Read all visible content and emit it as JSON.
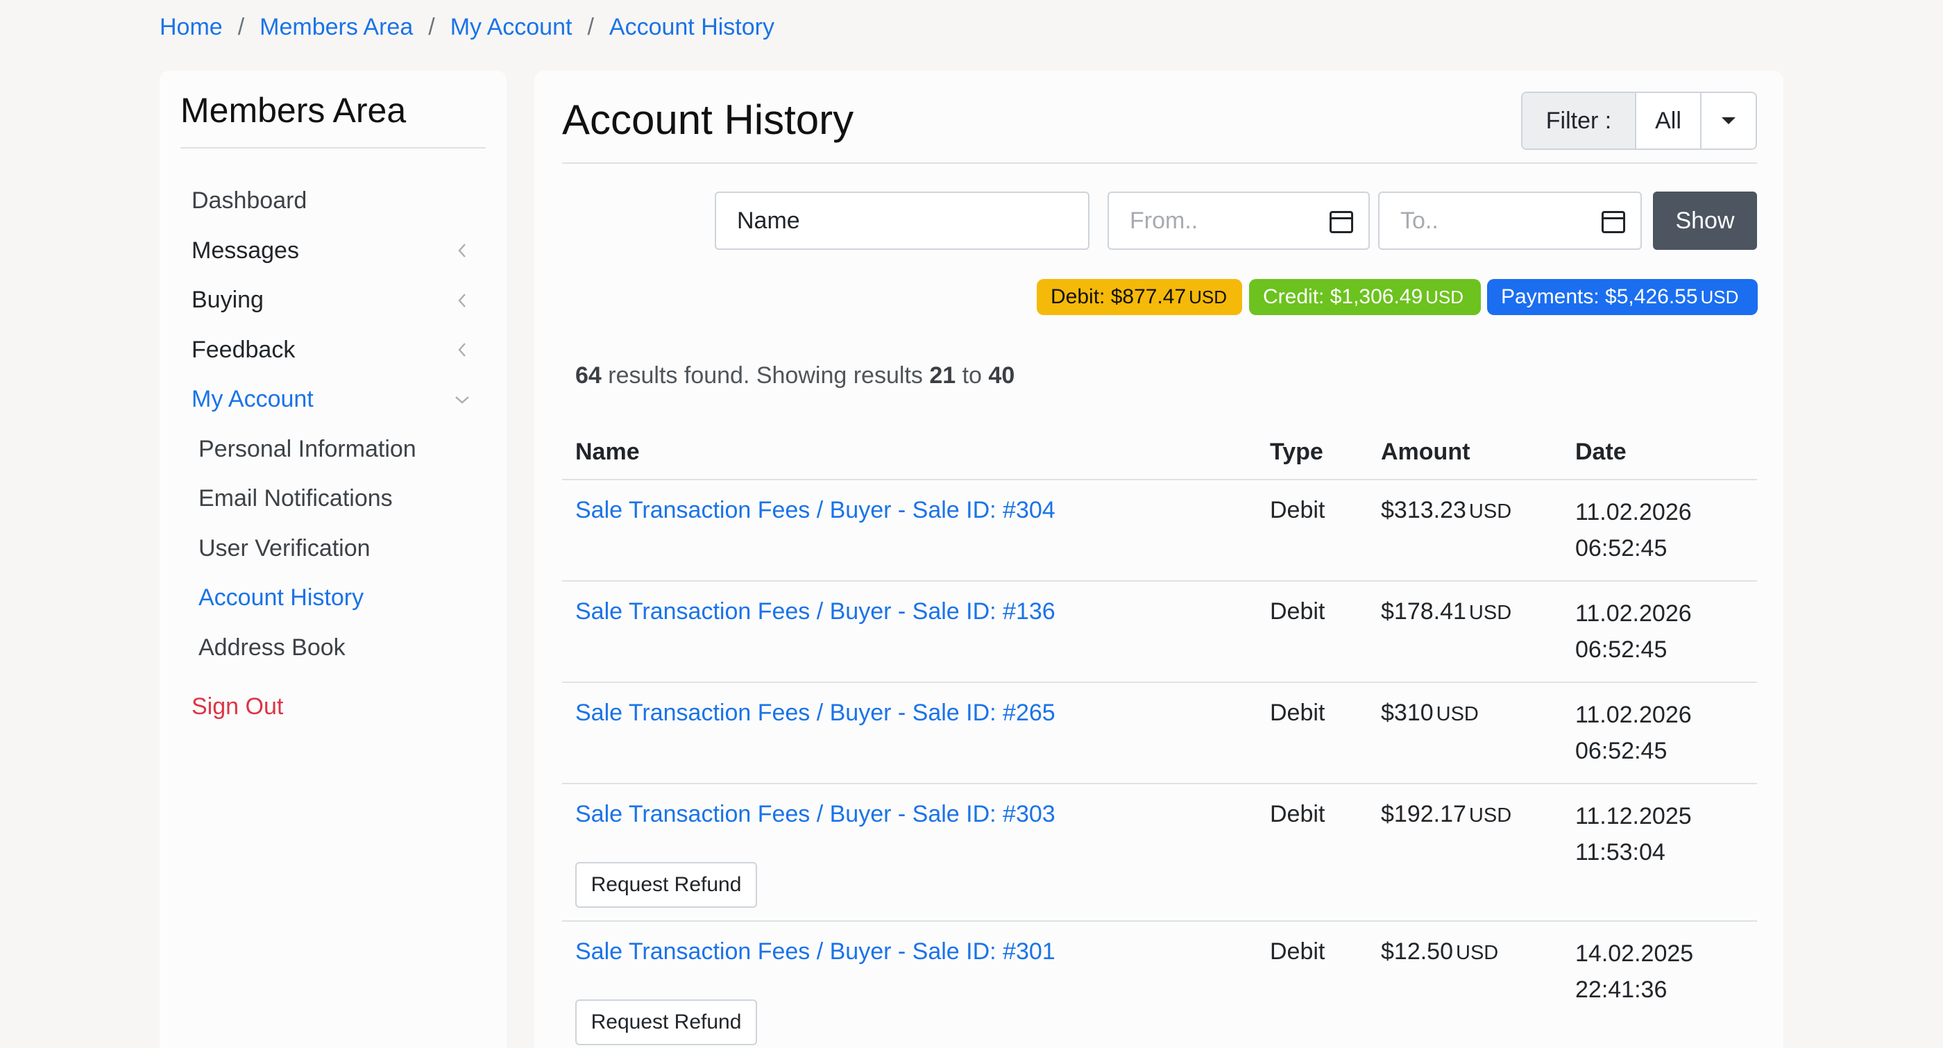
{
  "breadcrumb": [
    "Home",
    "Members Area",
    "My Account",
    "Account History"
  ],
  "breadcrumb_separator": "/",
  "sidebar": {
    "title": "Members Area",
    "items": [
      {
        "label": "Dashboard"
      },
      {
        "label": "Messages"
      },
      {
        "label": "Buying"
      },
      {
        "label": "Feedback"
      },
      {
        "label": "My Account"
      }
    ],
    "subitems": [
      {
        "label": "Personal Information"
      },
      {
        "label": "Email Notifications"
      },
      {
        "label": "User Verification"
      },
      {
        "label": "Account History"
      },
      {
        "label": "Address Book"
      }
    ],
    "signout": "Sign Out"
  },
  "main": {
    "title": "Account History",
    "filter": {
      "label": "Filter :",
      "value": "All"
    },
    "search": {
      "name_value": "Name",
      "from_placeholder": "From..",
      "to_placeholder": "To..",
      "show_label": "Show"
    },
    "badges": {
      "debit": {
        "label": "Debit: $877.47",
        "currency": "USD"
      },
      "credit": {
        "label": "Credit: $1,306.49",
        "currency": "USD"
      },
      "payments": {
        "label": "Payments: $5,426.55",
        "currency": "USD"
      }
    },
    "results": {
      "total": "64",
      "text1": "results found. Showing results",
      "from": "21",
      "to_word": "to",
      "to": "40"
    },
    "table": {
      "headers": {
        "name": "Name",
        "type": "Type",
        "amount": "Amount",
        "date": "Date"
      },
      "rows": [
        {
          "name": "Sale Transaction Fees / Buyer - Sale ID: #304",
          "type": "Debit",
          "amount": "$313.23",
          "currency": "USD",
          "date": "11.02.2026",
          "time": "06:52:45",
          "refund": ""
        },
        {
          "name": "Sale Transaction Fees / Buyer - Sale ID: #136",
          "type": "Debit",
          "amount": "$178.41",
          "currency": "USD",
          "date": "11.02.2026",
          "time": "06:52:45",
          "refund": ""
        },
        {
          "name": "Sale Transaction Fees / Buyer - Sale ID: #265",
          "type": "Debit",
          "amount": "$310",
          "currency": "USD",
          "date": "11.02.2026",
          "time": "06:52:45",
          "refund": ""
        },
        {
          "name": "Sale Transaction Fees / Buyer - Sale ID: #303",
          "type": "Debit",
          "amount": "$192.17",
          "currency": "USD",
          "date": "11.12.2025",
          "time": "11:53:04",
          "refund": "Request Refund"
        },
        {
          "name": "Sale Transaction Fees / Buyer - Sale ID: #301",
          "type": "Debit",
          "amount": "$12.50",
          "currency": "USD",
          "date": "14.02.2025",
          "time": "22:41:36",
          "refund": "Request Refund"
        }
      ]
    }
  },
  "colors": {
    "link": "#1a73e8",
    "debit_badge": "#f5b90a",
    "credit_badge": "#6cc21e",
    "payments_badge": "#1b6ef0",
    "signout": "#dc3545",
    "show_button": "#4c5560"
  }
}
